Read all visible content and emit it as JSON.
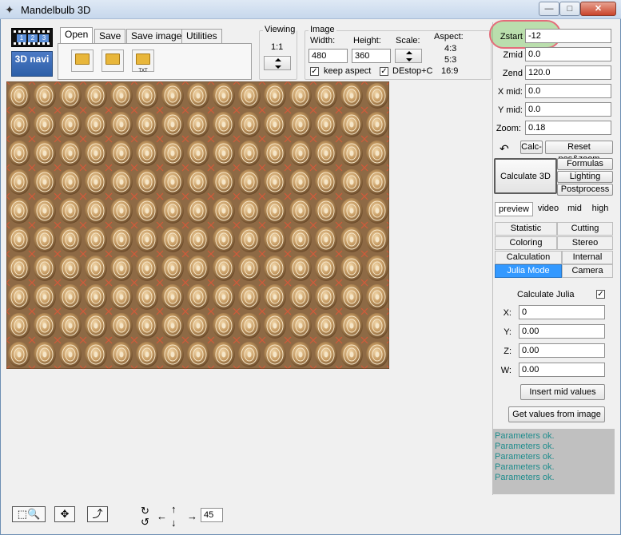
{
  "window": {
    "title": "Mandelbulb 3D",
    "min": "—",
    "max": "□",
    "close": "✕"
  },
  "toolbar": {
    "tabs": [
      "Open",
      "Save",
      "Save image",
      "Utilities"
    ],
    "open_buttons": [
      "",
      "",
      "TXT"
    ],
    "navi_label": "3D navi",
    "film_numbers": [
      "1",
      "2",
      "3"
    ]
  },
  "viewing": {
    "label": "Viewing",
    "value": "1:1"
  },
  "image": {
    "label": "Image",
    "width_label": "Width:",
    "width": "480",
    "height_label": "Height:",
    "height": "360",
    "scale_label": "Scale:",
    "aspect_label": "Aspect:",
    "aspects": [
      "4:3",
      "5:3",
      "16:9"
    ],
    "keep_aspect_label": "keep aspect",
    "keep_aspect_checked": "✓",
    "destop_label": "DEstop+C",
    "destop_checked": "✓"
  },
  "params": {
    "zstart_label": "Zstart",
    "zstart": "-12",
    "zmid_label": "Zmid",
    "zmid": "0.0",
    "zend_label": "Zend",
    "zend": "120.0",
    "xmid_label": "X mid:",
    "xmid": "0.0",
    "ymid_label": "Y mid:",
    "ymid": "0.0",
    "zoom_label": "Zoom:",
    "zoom": "0.18"
  },
  "actions": {
    "undo": "↶",
    "calc": "Calc-",
    "reset": "Reset pos&zoom",
    "calc3d": "Calculate 3D",
    "formulas": "Formulas",
    "lighting": "Lighting",
    "postprocess": "Postprocess"
  },
  "quality_tabs": [
    "preview",
    "video",
    "mid",
    "high"
  ],
  "grid_tabs": [
    "Statistic",
    "Cutting",
    "Coloring",
    "Stereo",
    "Calculation",
    "Internal",
    "Julia Mode",
    "Camera"
  ],
  "julia": {
    "calc_label": "Calculate Julia",
    "calc_checked": "✓",
    "x_label": "X:",
    "x": "0",
    "y_label": "Y:",
    "y": "0.00",
    "z_label": "Z:",
    "z": "0.00",
    "w_label": "W:",
    "w": "0.00",
    "insert_mid": "Insert mid values",
    "get_values": "Get values from image"
  },
  "log": [
    "Parameters ok.",
    "Parameters ok.",
    "Parameters ok.",
    "Parameters ok.",
    "Parameters ok."
  ],
  "bottom": {
    "select_zoom_icon": "⬚🔍",
    "move_icon": "✥",
    "draw_icon": "⤴",
    "angle": "45"
  },
  "colors": {
    "selected_tab": "#3399ff",
    "log_text": "#1e8c8c",
    "highlight_fill": "#78c85a",
    "highlight_stroke": "#e46c7a"
  }
}
